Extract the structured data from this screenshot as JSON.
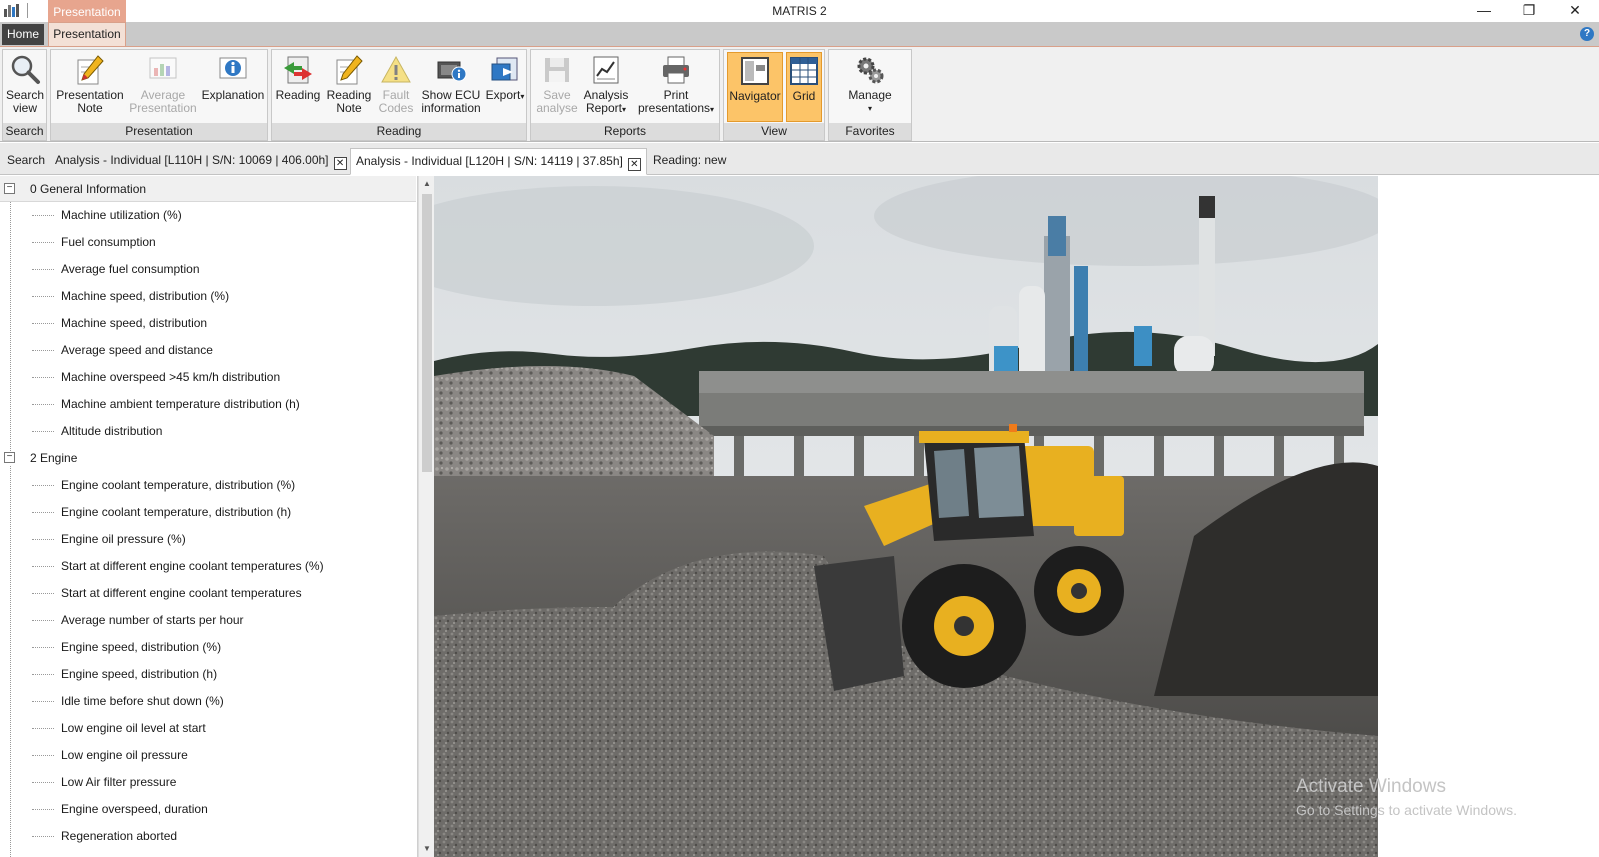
{
  "window": {
    "title": "MATRIS 2",
    "context_tab_label": "Presentation",
    "controls": {
      "minimize": "—",
      "restore": "❐",
      "close": "✕"
    }
  },
  "tabs": {
    "home": "Home",
    "presentation": "Presentation",
    "help": "?"
  },
  "ribbon": {
    "groups": {
      "search": "Search",
      "presentation": "Presentation",
      "reading": "Reading",
      "reports": "Reports",
      "view": "View",
      "favorites": "Favorites"
    },
    "buttons": {
      "search_view": [
        "Search",
        "view"
      ],
      "presentation_note": [
        "Presentation",
        "Note"
      ],
      "average_presentation": [
        "Average",
        "Presentation"
      ],
      "explanation": [
        "Explanation"
      ],
      "reading": [
        "Reading"
      ],
      "reading_note": [
        "Reading",
        "Note"
      ],
      "fault_codes": [
        "Fault",
        "Codes"
      ],
      "show_ecu": [
        "Show ECU",
        "information"
      ],
      "export": [
        "Export"
      ],
      "save_analyse": [
        "Save",
        "analyse"
      ],
      "analysis_report": [
        "Analysis",
        "Report"
      ],
      "print_presentations": [
        "Print",
        "presentations"
      ],
      "navigator": [
        "Navigator"
      ],
      "grid": [
        "Grid"
      ],
      "manage": [
        "Manage"
      ]
    }
  },
  "doc_tabs": {
    "search": "Search",
    "tab1": "Analysis - Individual [L110H | S/N: 10069 | 406.00h]",
    "tab2": "Analysis - Individual [L120H | S/N: 14119 | 37.85h]",
    "reading": "Reading: new",
    "close_glyph": "✕"
  },
  "tree": {
    "groups": [
      {
        "label": "0 General Information",
        "items": [
          "Machine utilization (%)",
          "Fuel consumption",
          "Average fuel consumption",
          "Machine speed, distribution (%)",
          "Machine speed, distribution",
          "Average speed and distance",
          "Machine overspeed >45 km/h distribution",
          "Machine ambient temperature distribution (h)",
          "Altitude distribution"
        ]
      },
      {
        "label": "2 Engine",
        "items": [
          "Engine coolant temperature, distribution (%)",
          "Engine coolant temperature, distribution (h)",
          "Engine oil pressure (%)",
          "Start at different engine coolant temperatures (%)",
          "Start at different engine coolant temperatures",
          "Average number of starts per hour",
          "Engine speed, distribution (%)",
          "Engine speed, distribution (h)",
          "Idle time before shut down (%)",
          "Low engine oil level at start",
          "Low engine oil pressure",
          "Low Air filter pressure",
          "Engine overspeed, duration",
          "Regeneration aborted"
        ]
      }
    ],
    "expander_glyph": "−"
  },
  "watermark": {
    "line1": "Activate Windows",
    "line2": "Go to Settings to activate Windows."
  },
  "colors": {
    "context_accent": "#e7a58e",
    "active_view_button": "#fcc468",
    "loader_yellow": "#f0b41e",
    "help_blue": "#2f78c4"
  }
}
